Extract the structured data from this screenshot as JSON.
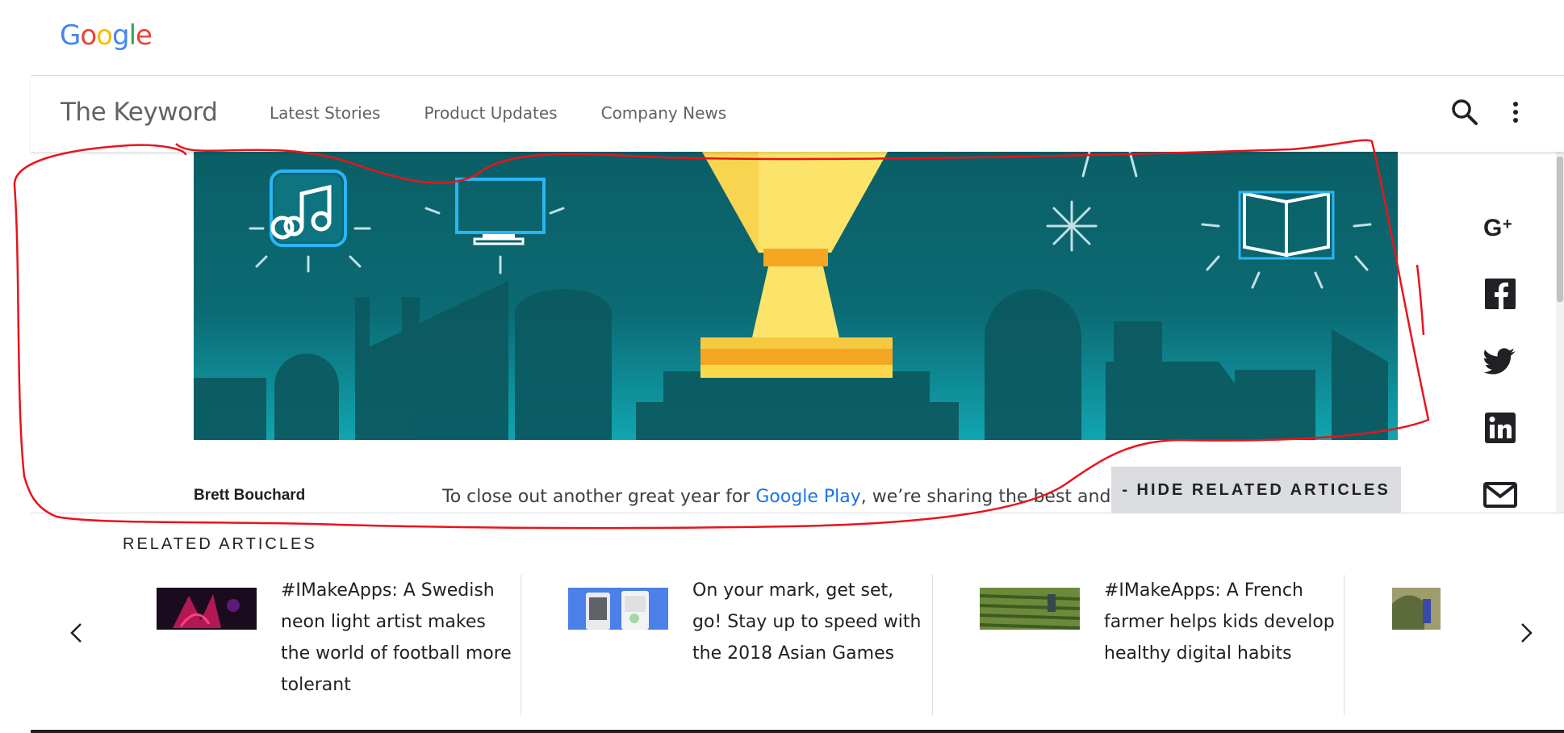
{
  "google_bar": {
    "logo_letters": [
      {
        "char": "G",
        "color": "#4285F4"
      },
      {
        "char": "o",
        "color": "#EA4335"
      },
      {
        "char": "o",
        "color": "#FBBC05"
      },
      {
        "char": "g",
        "color": "#4285F4"
      },
      {
        "char": "l",
        "color": "#34A853"
      },
      {
        "char": "e",
        "color": "#EA4335"
      }
    ]
  },
  "header": {
    "title": "The Keyword",
    "nav": [
      "Latest Stories",
      "Product Updates",
      "Company News"
    ],
    "search_icon": "search-icon",
    "more_icon": "more-vert-icon"
  },
  "hero": {
    "background": "#0b6a73",
    "trophy_color": "#fcd94a",
    "icons": [
      "music-icon",
      "tv-icon",
      "book-icon",
      "trophy-icon"
    ]
  },
  "social": {
    "items": [
      {
        "name": "google-plus-icon",
        "label": "G+"
      },
      {
        "name": "facebook-icon",
        "label": "f"
      },
      {
        "name": "twitter-icon",
        "label": ""
      },
      {
        "name": "linkedin-icon",
        "label": "in"
      },
      {
        "name": "mail-icon",
        "label": ""
      }
    ]
  },
  "article": {
    "author": "Brett Bouchard",
    "intro_before": "To close out another great year for ",
    "intro_link": "Google Play",
    "intro_after": ", we’re sharing the best and most",
    "hide_button": "- HIDE RELATED ARTICLES"
  },
  "related": {
    "heading": "RELATED ARTICLES",
    "cards": [
      {
        "title": "#IMakeApps: A Swedish neon light artist makes the world of football more tolerant",
        "thumb": "neon-artist-thumb"
      },
      {
        "title": "On your mark, get set, go! Stay up to speed with the 2018 Asian Games",
        "thumb": "asian-games-thumb"
      },
      {
        "title": "#IMakeApps: A French farmer helps kids develop healthy digital habits",
        "thumb": "farmer-thumb"
      },
      {
        "title": "",
        "thumb": "outdoor-thumb"
      }
    ]
  },
  "annotation_color": "#e8141b"
}
